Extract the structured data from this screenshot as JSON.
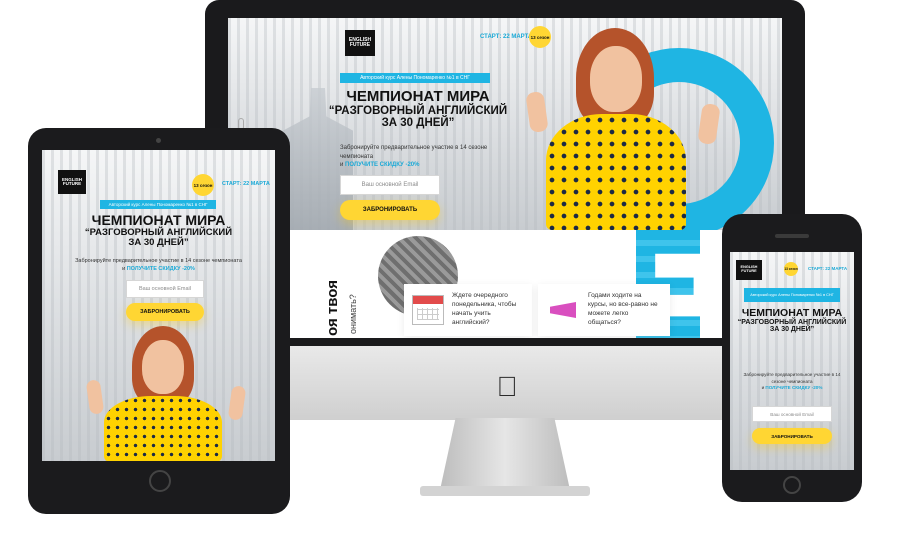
{
  "brand": {
    "logo_line1": "ENGLISH",
    "logo_line2": "FUTURE"
  },
  "badge": {
    "season": "13 сезон"
  },
  "start": {
    "label": "СТАРТ: 22 МАРТА"
  },
  "strip": {
    "text": "Авторский курс Алены Пономаренко №1 в СНГ"
  },
  "headline": {
    "line1": "ЧЕМПИОНАТ МИРА",
    "line2": "“РАЗГОВОРНЫЙ АНГЛИЙСКИЙ",
    "line3": "ЗА 30 ДНЕЙ”"
  },
  "sub": {
    "text": "Забронируйте предварительное участие в 14 сезоне чемпионата",
    "and": "и",
    "promo": "ПОЛУЧИТЕ СКИДКУ -20%"
  },
  "form": {
    "email_placeholder": "Ваш основной Email",
    "cta_label": "ЗАБРОНИРОВАТЬ"
  },
  "section2": {
    "side_title": "оя твоя",
    "side_sub": "онимать?",
    "cards": [
      {
        "text": "Ждете очередного понедельника, чтобы начать учить английский?",
        "icon": "calendar-icon"
      },
      {
        "text": "Годами ходите на курсы, но все-равно не можете легко общаться?",
        "icon": "megaphone-icon"
      }
    ]
  },
  "colors": {
    "accent_blue": "#1fb5e3",
    "accent_yellow": "#ffd633",
    "frame": "#1b1b1d"
  }
}
